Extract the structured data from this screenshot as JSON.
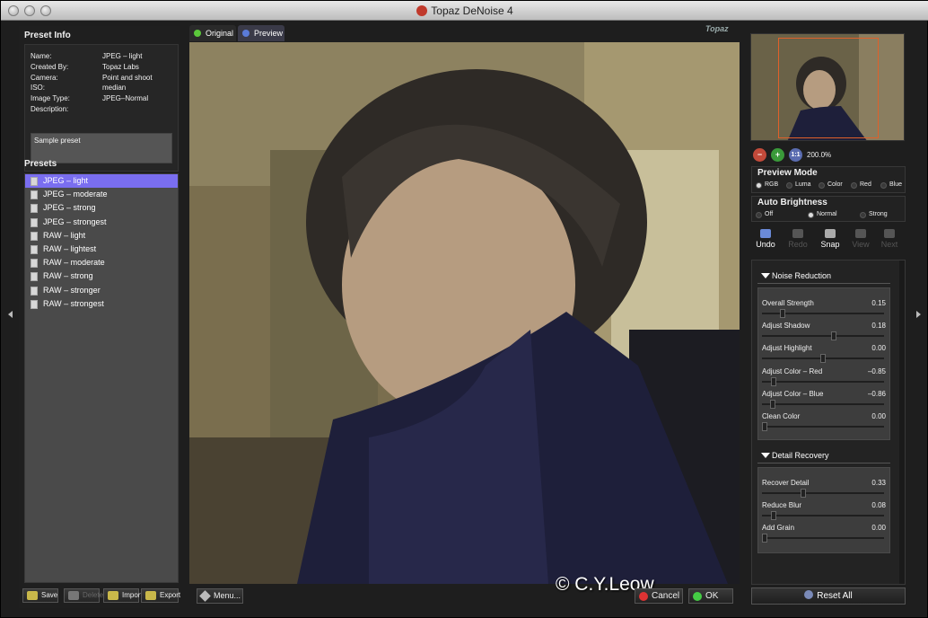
{
  "window": {
    "title": "Topaz DeNoise 4"
  },
  "preset_info": {
    "heading": "Preset Info",
    "rows": [
      {
        "key": "Name:",
        "value": "JPEG – light"
      },
      {
        "key": "Created By:",
        "value": "Topaz Labs"
      },
      {
        "key": "Camera:",
        "value": "Point and shoot"
      },
      {
        "key": "ISO:",
        "value": "median"
      },
      {
        "key": "Image Type:",
        "value": "JPEG–Normal"
      },
      {
        "key": "Description:",
        "value": ""
      }
    ],
    "description": "Sample preset"
  },
  "presets": {
    "heading": "Presets",
    "items": [
      "JPEG – light",
      "JPEG – moderate",
      "JPEG – strong",
      "JPEG – strongest",
      "RAW – light",
      "RAW – lightest",
      "RAW – moderate",
      "RAW – strong",
      "RAW – stronger",
      "RAW – strongest"
    ],
    "selected": 0,
    "buttons": {
      "save": "Save",
      "delete": "Delete",
      "import": "Import",
      "export": "Export"
    }
  },
  "view_tabs": {
    "original": "Original",
    "preview": "Preview"
  },
  "brand_logo": "Topaz",
  "bottom": {
    "menu": "Menu...",
    "watermark": "© C.Y.Leow",
    "cancel": "Cancel",
    "ok": "OK"
  },
  "navigator": {
    "zoom": "200.0%"
  },
  "preview_mode": {
    "title": "Preview Mode",
    "options": [
      "RGB",
      "Luma",
      "Color",
      "Red",
      "Blue"
    ],
    "selected": 0
  },
  "auto_brightness": {
    "title": "Auto Brightness",
    "options": [
      "Off",
      "Normal",
      "Strong"
    ],
    "selected": 1
  },
  "tools": {
    "undo": "Undo",
    "redo": "Redo",
    "snap": "Snap",
    "view": "View",
    "next": "Next"
  },
  "noise_reduction": {
    "title": "Noise Reduction",
    "sliders": [
      {
        "label": "Overall Strength",
        "value": "0.15",
        "level": 0.15
      },
      {
        "label": "Adjust Shadow",
        "value": "0.18",
        "level": 0.59
      },
      {
        "label": "Adjust Highlight",
        "value": "0.00",
        "level": 0.5
      },
      {
        "label": "Adjust Color – Red",
        "value": "–0.85",
        "level": 0.075
      },
      {
        "label": "Adjust Color – Blue",
        "value": "–0.86",
        "level": 0.07
      },
      {
        "label": "Clean Color",
        "value": "0.00",
        "level": 0.0
      }
    ]
  },
  "detail_recovery": {
    "title": "Detail Recovery",
    "sliders": [
      {
        "label": "Recover Detail",
        "value": "0.33",
        "level": 0.33
      },
      {
        "label": "Reduce Blur",
        "value": "0.08",
        "level": 0.08
      },
      {
        "label": "Add Grain",
        "value": "0.00",
        "level": 0.0
      }
    ]
  },
  "reset": "Reset All",
  "colors": {
    "selection": "#7a6ef0",
    "accent_orange": "#e0602a",
    "original_dot": "#5bc83b",
    "preview_dot": "#5a7bd8"
  }
}
